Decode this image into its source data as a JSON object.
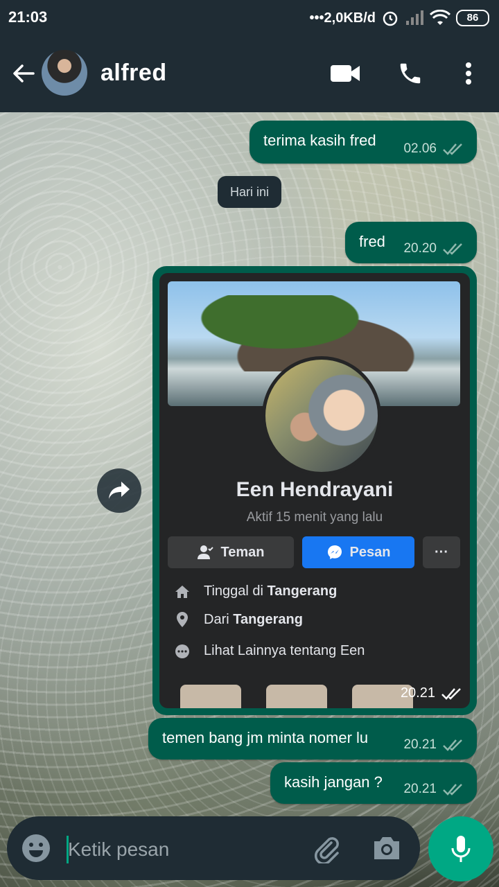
{
  "status_bar": {
    "time": "21:03",
    "network_speed": "•••2,0KB/d",
    "battery": "86"
  },
  "header": {
    "contact_name": "alfred",
    "icons": [
      "back-arrow-icon",
      "video-call-icon",
      "voice-call-icon",
      "more-options-icon"
    ]
  },
  "messages": [
    {
      "text": "terima kasih fred",
      "time": "02.06"
    },
    {
      "text": "fred",
      "time": "20.20"
    },
    {
      "text": "temen bang jm minta nomer lu",
      "time": "20.21"
    },
    {
      "text": "kasih jangan ?",
      "time": "20.21"
    }
  ],
  "date_chip": "Hari ini",
  "image_message": {
    "time": "20.21",
    "profile_card": {
      "name": "Een Hendrayani",
      "active": "Aktif 15 menit yang lalu",
      "buttons": {
        "friend": "Teman",
        "message": "Pesan",
        "more": "···"
      },
      "info": {
        "live_prefix": "Tinggal di ",
        "live_city": "Tangerang",
        "from_prefix": "Dari ",
        "from_city": "Tangerang",
        "see_more": "Lihat Lainnya tentang Een"
      }
    }
  },
  "input": {
    "placeholder": "Ketik pesan"
  },
  "colors": {
    "header_bg": "#1f2c34",
    "outgoing_bubble": "#005c4b",
    "accent_green": "#00a884",
    "fb_blue": "#1877f2"
  }
}
